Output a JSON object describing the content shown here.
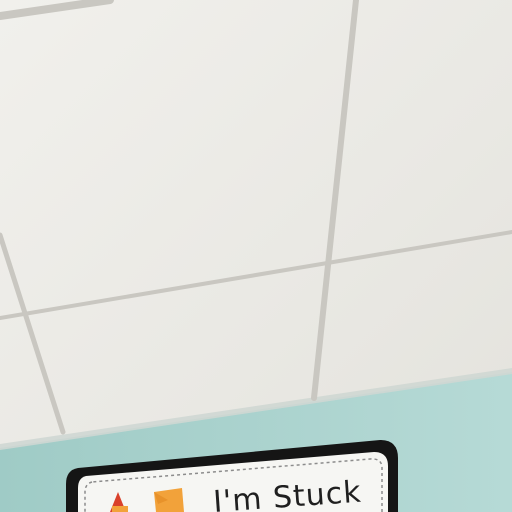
{
  "scene": {
    "description_tags": [
      "ceiling-tiles",
      "wall",
      "classroom-sign"
    ],
    "colors": {
      "ceiling": "#ecebe6",
      "ceiling_shadow": "#e2e1dc",
      "grid": "#c9c7c1",
      "wall": "#a9d2cd",
      "wall_light": "#b6dad6",
      "sign_border": "#151515",
      "sign_face": "#f6f6f3",
      "accent_orange": "#f2a23a",
      "accent_red": "#d9412b"
    }
  },
  "sign": {
    "text": "I'm Stuck"
  }
}
